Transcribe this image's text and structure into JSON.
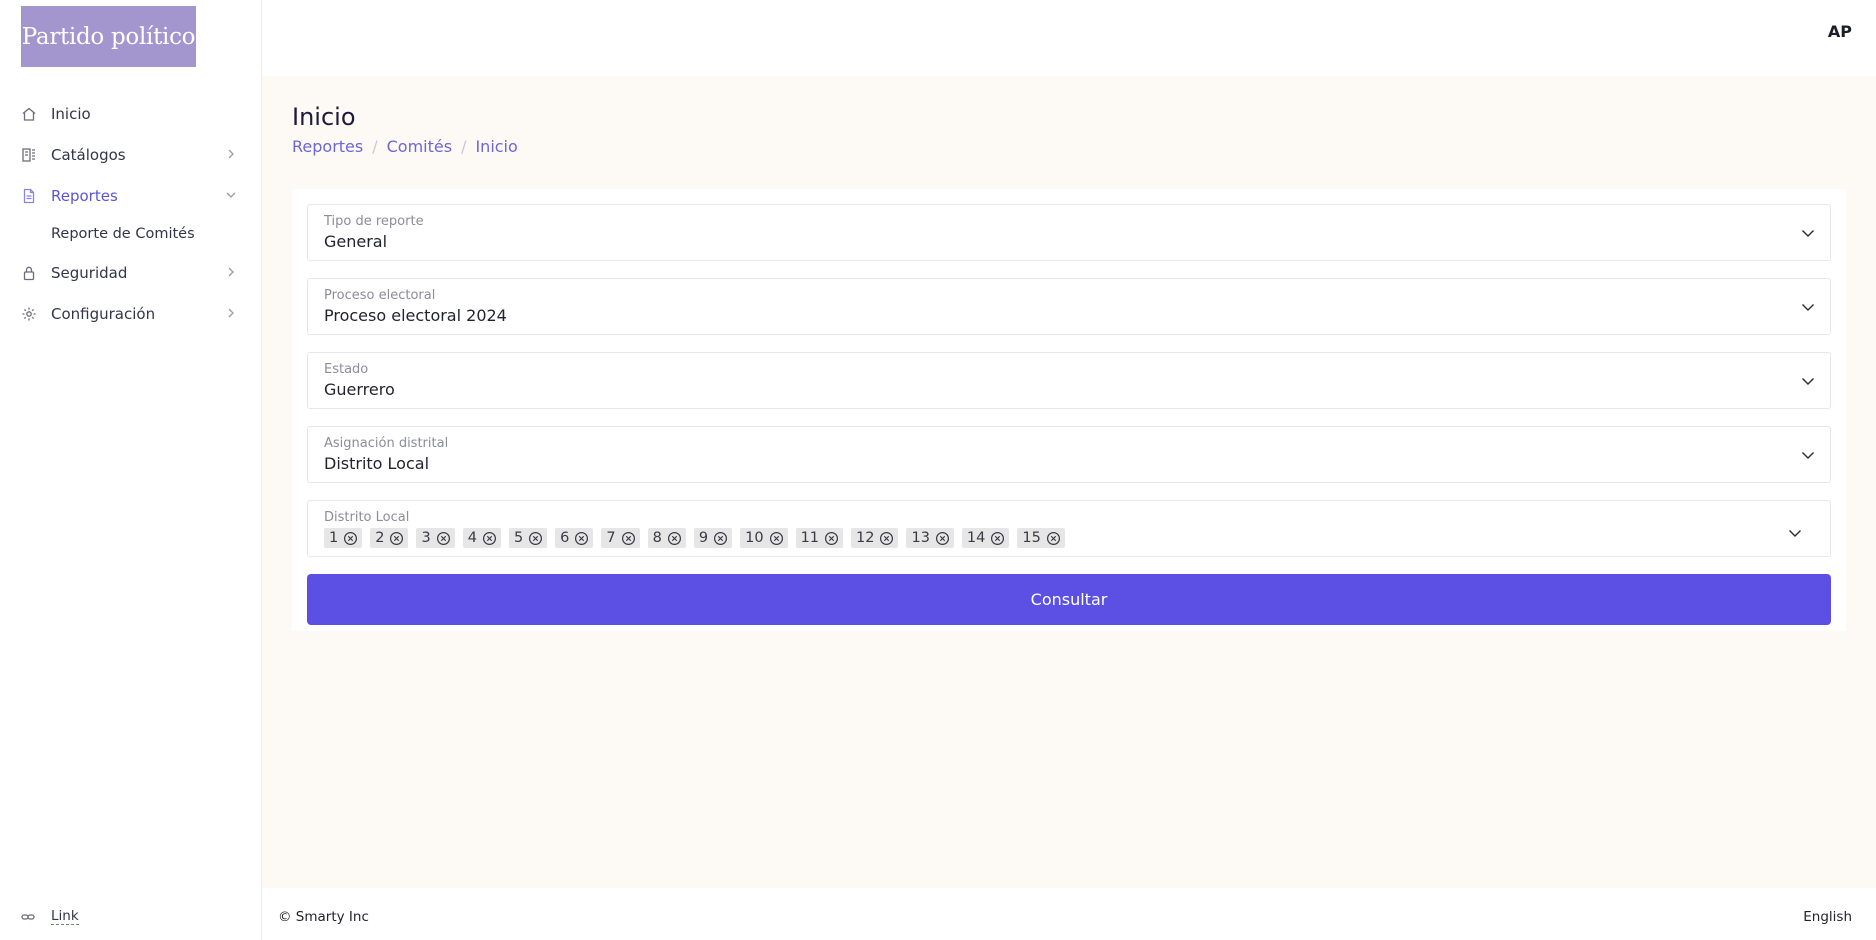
{
  "sidebar": {
    "logo_text": "Partido político",
    "items": [
      {
        "label": "Inicio",
        "icon": "home-icon"
      },
      {
        "label": "Catálogos",
        "icon": "catalog-icon"
      },
      {
        "label": "Reportes",
        "icon": "document-icon",
        "sub": [
          "Reporte de Comités"
        ]
      },
      {
        "label": "Seguridad",
        "icon": "lock-icon"
      },
      {
        "label": "Configuración",
        "icon": "gear-icon"
      }
    ],
    "footer_link": "Link"
  },
  "header": {
    "avatar_initials": "AP"
  },
  "main": {
    "title": "Inicio",
    "breadcrumb": [
      "Reportes",
      "Comités",
      "Inicio"
    ],
    "fields": [
      {
        "label": "Tipo de reporte",
        "value": "General"
      },
      {
        "label": "Proceso electoral",
        "value": "Proceso electoral 2024"
      },
      {
        "label": "Estado",
        "value": "Guerrero"
      },
      {
        "label": "Asignación distrital",
        "value": "Distrito Local"
      },
      {
        "label": "Distrito Local",
        "tags": [
          "1",
          "2",
          "3",
          "4",
          "5",
          "6",
          "7",
          "8",
          "9",
          "10",
          "11",
          "12",
          "13",
          "14",
          "15"
        ]
      }
    ],
    "submit_label": "Consultar"
  },
  "footer": {
    "copyright": "© Smarty Inc",
    "language": "English"
  },
  "colors": {
    "accent": "#5b50e3",
    "link": "#6c66d8",
    "logo_bg": "#a396cf",
    "content_bg": "#fdfaf5"
  }
}
